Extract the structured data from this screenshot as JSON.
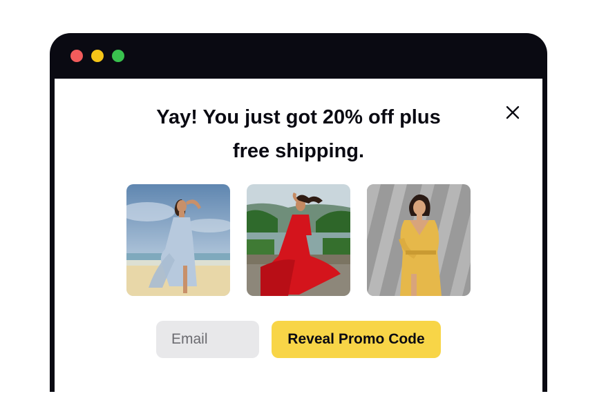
{
  "window": {
    "controls": [
      {
        "name": "close",
        "color": "#f25c5c"
      },
      {
        "name": "minimize",
        "color": "#f5c518"
      },
      {
        "name": "maximize",
        "color": "#39c24e"
      }
    ],
    "frame_color": "#0a0a12"
  },
  "popup": {
    "close_icon": "close-icon",
    "headline_line1": "Yay! You just got 20% off plus",
    "headline_line2": "free shipping.",
    "photos": [
      {
        "name": "woman-blue-dress-beach-photo",
        "dress_color": "#b7c9dd"
      },
      {
        "name": "woman-red-dress-river-photo",
        "dress_color": "#d4141c"
      },
      {
        "name": "woman-yellow-dress-wall-photo",
        "dress_color": "#e6b84a"
      }
    ],
    "email_placeholder": "Email",
    "email_value": "",
    "cta_label": "Reveal Promo Code",
    "cta_color": "#f8d547"
  }
}
